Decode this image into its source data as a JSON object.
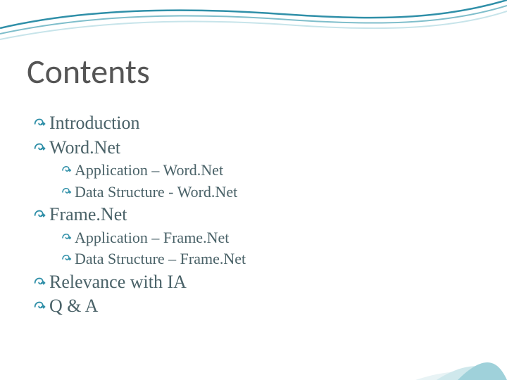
{
  "slide": {
    "title": "Contents",
    "items": [
      {
        "level": 1,
        "text": "Introduction"
      },
      {
        "level": 1,
        "text": "Word.Net"
      },
      {
        "level": 2,
        "text": "Application – Word.Net"
      },
      {
        "level": 2,
        "text": "Data Structure - Word.Net"
      },
      {
        "level": 1,
        "text": "Frame.Net"
      },
      {
        "level": 2,
        "text": "Application – Frame.Net"
      },
      {
        "level": 2,
        "text": "Data Structure – Frame.Net"
      },
      {
        "level": 1,
        "text": "Relevance with IA"
      },
      {
        "level": 1,
        "text": "Q & A"
      }
    ]
  },
  "theme": {
    "accent": "#2f8fa8",
    "text_muted": "#4a6268",
    "title_color": "#555555"
  }
}
